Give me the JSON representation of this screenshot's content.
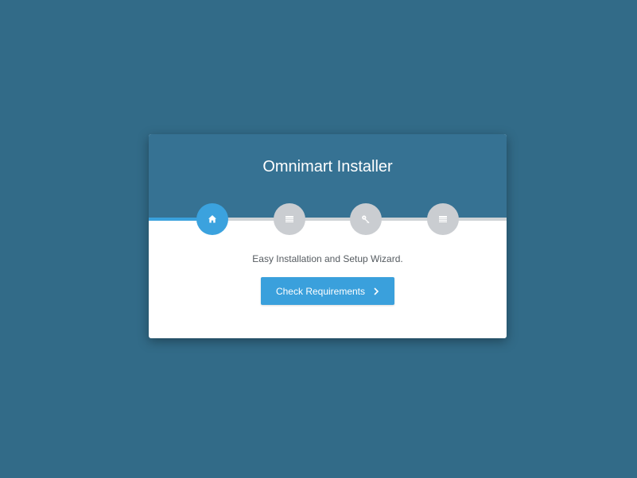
{
  "colors": {
    "page_background": "#326b88",
    "header_background": "#367293",
    "accent": "#3aa1dd",
    "step_inactive": "#cacdd1",
    "card_background": "#ffffff"
  },
  "installer": {
    "title": "Omnimart Installer",
    "subtitle": "Easy Installation and Setup Wizard.",
    "progress": 0.14,
    "steps": [
      {
        "icon": "home-icon",
        "active": true
      },
      {
        "icon": "list-icon",
        "active": false
      },
      {
        "icon": "key-icon",
        "active": false
      },
      {
        "icon": "list-icon",
        "active": false
      }
    ],
    "primary_button": {
      "label": "Check Requirements",
      "icon": "chevron-right-icon"
    }
  }
}
